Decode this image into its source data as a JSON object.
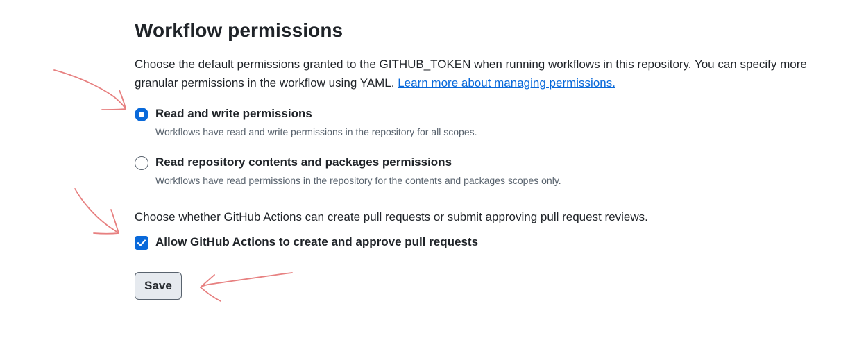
{
  "section": {
    "title": "Workflow permissions",
    "description": "Choose the default permissions granted to the GITHUB_TOKEN when running workflows in this repository. You can specify more granular permissions in the workflow using YAML.",
    "learn_more_link": "Learn more about managing permissions."
  },
  "permission_options": [
    {
      "label": "Read and write permissions",
      "note": "Workflows have read and write permissions in the repository for all scopes.",
      "selected": true
    },
    {
      "label": "Read repository contents and packages permissions",
      "note": "Workflows have read permissions in the repository for the contents and packages scopes only.",
      "selected": false
    }
  ],
  "pull_requests": {
    "question": "Choose whether GitHub Actions can create pull requests or submit approving pull request reviews.",
    "checkbox_label": "Allow GitHub Actions to create and approve pull requests",
    "checked": true
  },
  "actions": {
    "save_label": "Save"
  },
  "colors": {
    "accent": "#0969da",
    "annotation_arrow": "#e36b6b"
  }
}
